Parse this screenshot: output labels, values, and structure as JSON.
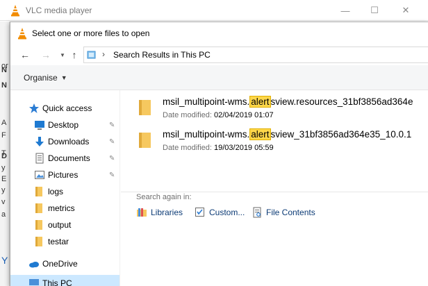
{
  "vlc": {
    "title": "VLC media player",
    "controls": {
      "minimize": "—",
      "maximize": "☐",
      "close": "✕"
    },
    "bg_fragments": [
      "or",
      "N",
      "N",
      "A",
      "F",
      "T",
      "D",
      "y",
      "E",
      "y",
      "v",
      "a",
      "Y"
    ]
  },
  "dialog": {
    "title": "Select one or more files to open",
    "nav": {
      "back": "←",
      "forward": "→",
      "up": "↑"
    },
    "address": {
      "separator": "›",
      "text": "Search Results in This PC"
    },
    "toolbar": {
      "organise": "Organise",
      "caret": "▼"
    },
    "navpane": {
      "items": [
        {
          "label": "Quick access",
          "icon": "star-icon"
        },
        {
          "label": "Desktop",
          "icon": "desktop-icon",
          "pinned": true
        },
        {
          "label": "Downloads",
          "icon": "download-icon",
          "pinned": true
        },
        {
          "label": "Documents",
          "icon": "documents-icon",
          "pinned": true
        },
        {
          "label": "Pictures",
          "icon": "pictures-icon",
          "pinned": true
        },
        {
          "label": "logs",
          "icon": "folder-icon"
        },
        {
          "label": "metrics",
          "icon": "folder-icon"
        },
        {
          "label": "output",
          "icon": "folder-icon"
        },
        {
          "label": "testar",
          "icon": "folder-icon"
        },
        {
          "label": "OneDrive",
          "icon": "cloud-icon"
        },
        {
          "label": "This PC",
          "icon": "computer-icon"
        }
      ],
      "pin_glyph": "📌"
    },
    "results": {
      "files": [
        {
          "name_before": "msil_multipoint-wms.",
          "name_highlight": "alert",
          "name_after": "sview.resources_31bf3856ad364e",
          "date_label": "Date modified:",
          "date_value": "02/04/2019 01:07"
        },
        {
          "name_before": "msil_multipoint-wms.",
          "name_highlight": "alert",
          "name_after": "sview_31bf3856ad364e35_10.0.1",
          "date_label": "Date modified:",
          "date_value": "19/03/2019 05:59"
        }
      ],
      "search_again": "Search again in:",
      "search_again_items": [
        {
          "label": "Libraries",
          "icon": "libraries-icon"
        },
        {
          "label": "Custom...",
          "icon": "custom-search-icon"
        },
        {
          "label": "File Contents",
          "icon": "file-contents-icon"
        }
      ]
    }
  },
  "colors": {
    "highlight": "#fdd64a",
    "folder": "#f6c85f",
    "accent": "#0078d7"
  }
}
